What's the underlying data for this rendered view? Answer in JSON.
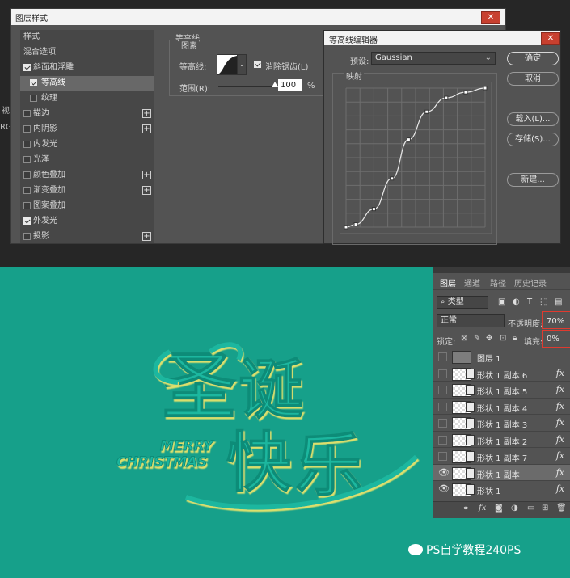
{
  "layer_style": {
    "title": "图层样式",
    "items": [
      {
        "label": "样式",
        "type": "hdr"
      },
      {
        "label": "混合选项",
        "type": "hdr"
      },
      {
        "label": "斜面和浮雕",
        "checked": true,
        "plus": false
      },
      {
        "label": "等高线",
        "checked": true,
        "plus": false,
        "sub": true,
        "selected": true
      },
      {
        "label": "纹理",
        "checked": false,
        "plus": false,
        "sub": true
      },
      {
        "label": "描边",
        "checked": false,
        "plus": true
      },
      {
        "label": "内阴影",
        "checked": false,
        "plus": true
      },
      {
        "label": "内发光",
        "checked": false,
        "plus": false
      },
      {
        "label": "光泽",
        "checked": false,
        "plus": false
      },
      {
        "label": "颜色叠加",
        "checked": false,
        "plus": true
      },
      {
        "label": "渐变叠加",
        "checked": false,
        "plus": true
      },
      {
        "label": "图案叠加",
        "checked": false,
        "plus": false
      },
      {
        "label": "外发光",
        "checked": true,
        "plus": false
      },
      {
        "label": "投影",
        "checked": false,
        "plus": true
      }
    ]
  },
  "contour_panel": {
    "section_title": "等高线",
    "group_title": "图素",
    "contour_label": "等高线:",
    "antialias_label": "消除锯齿(L)",
    "antialias_checked": true,
    "range_label": "范围(R):",
    "range_value": "100",
    "range_unit": "%",
    "range_fraction": 1.0
  },
  "contour_editor": {
    "title": "等高线编辑器",
    "preset_label": "预设:",
    "preset_value": "Gaussian",
    "mapping_label": "映射",
    "buttons": {
      "ok": "确定",
      "cancel": "取消",
      "load": "载入(L)...",
      "save": "存储(S)...",
      "new": "新建..."
    },
    "curve_points": [
      [
        0,
        0
      ],
      [
        0.07,
        0.02
      ],
      [
        0.2,
        0.13
      ],
      [
        0.33,
        0.35
      ],
      [
        0.45,
        0.63
      ],
      [
        0.58,
        0.83
      ],
      [
        0.72,
        0.93
      ],
      [
        0.86,
        0.97
      ],
      [
        1.0,
        1.0
      ]
    ]
  },
  "partial_labels": {
    "left1": "视",
    "left2": "RG"
  },
  "layers_panel": {
    "tabs": [
      "图层",
      "通道",
      "路径",
      "历史记录"
    ],
    "filter_value": "类型",
    "blend_mode": "正常",
    "opacity_label": "不透明度:",
    "opacity_value": "70%",
    "lock_label": "锁定:",
    "fill_label": "填充:",
    "fill_value": "0%",
    "layers": [
      {
        "name": "图层 1",
        "visible": false,
        "fx": false,
        "thumb": "gray",
        "selected": false
      },
      {
        "name": "形状 1 副本 6",
        "visible": false,
        "fx": true,
        "thumb": "shape",
        "selected": false
      },
      {
        "name": "形状 1 副本 5",
        "visible": false,
        "fx": true,
        "thumb": "shape",
        "selected": false
      },
      {
        "name": "形状 1 副本 4",
        "visible": false,
        "fx": true,
        "thumb": "shape",
        "selected": false
      },
      {
        "name": "形状 1 副本 3",
        "visible": false,
        "fx": true,
        "thumb": "shape",
        "selected": false
      },
      {
        "name": "形状 1 副本 2",
        "visible": false,
        "fx": true,
        "thumb": "shape",
        "selected": false
      },
      {
        "name": "形状 1 副本 7",
        "visible": false,
        "fx": true,
        "thumb": "shape",
        "selected": false
      },
      {
        "name": "形状 1 副本",
        "visible": true,
        "fx": true,
        "thumb": "shape",
        "selected": true
      },
      {
        "name": "形状 1",
        "visible": true,
        "fx": true,
        "thumb": "shape",
        "selected": false
      }
    ],
    "fx_text": "fx"
  },
  "artwork": {
    "line1": "MERRY",
    "line2": "CHRISTMAS",
    "chars": [
      "圣",
      "诞",
      "快",
      "乐"
    ]
  },
  "watermark": "PS自学教程240PS",
  "colors": {
    "canvas": "#16a08a",
    "panel": "#535353",
    "highlight": "#e03a2f",
    "artwork": "#1fb79f",
    "artwork_edge": "#e6e36a"
  }
}
